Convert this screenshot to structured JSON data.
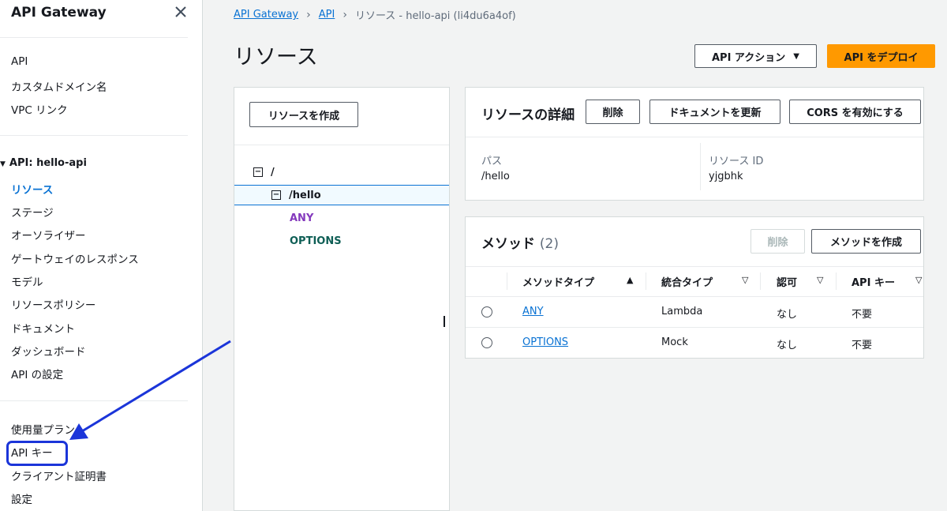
{
  "sidebar": {
    "title": "API Gateway",
    "top_items": [
      "API",
      "カスタムドメイン名",
      "VPC リンク"
    ],
    "group_label": "API: hello-api",
    "group_items": [
      "リソース",
      "ステージ",
      "オーソライザー",
      "ゲートウェイのレスポンス",
      "モデル",
      "リソースポリシー",
      "ドキュメント",
      "ダッシュボード",
      "API の設定"
    ],
    "bottom_items": [
      "使用量プラン",
      "API キー",
      "クライアント証明書",
      "設定"
    ]
  },
  "breadcrumb": {
    "items": [
      "API Gateway",
      "API"
    ],
    "current": "リソース - hello-api (li4du6a4of)"
  },
  "page_title": "リソース",
  "actions": {
    "api_actions": "API アクション",
    "deploy": "API をデプロイ"
  },
  "tree": {
    "create_button": "リソースを作成",
    "root": "/",
    "child": "/hello",
    "methods": [
      "ANY",
      "OPTIONS"
    ]
  },
  "detail": {
    "title": "リソースの詳細",
    "delete": "削除",
    "update_docs": "ドキュメントを更新",
    "enable_cors": "CORS を有効にする",
    "path_label": "パス",
    "path_value": "/hello",
    "id_label": "リソース ID",
    "id_value": "yjgbhk"
  },
  "methods_panel": {
    "title": "メソッド",
    "count": "(2)",
    "delete": "削除",
    "create": "メソッドを作成",
    "columns": [
      "メソッドタイプ",
      "統合タイプ",
      "認可",
      "API キー"
    ],
    "rows": [
      [
        "ANY",
        "Lambda",
        "なし",
        "不要"
      ],
      [
        "OPTIONS",
        "Mock",
        "なし",
        "不要"
      ]
    ]
  },
  "colors": {
    "link": "#0972d3",
    "primary_button": "#ff9900",
    "annotation": "#1b35d9",
    "method_any": "#8439bd",
    "method_options": "#0e5e55"
  }
}
